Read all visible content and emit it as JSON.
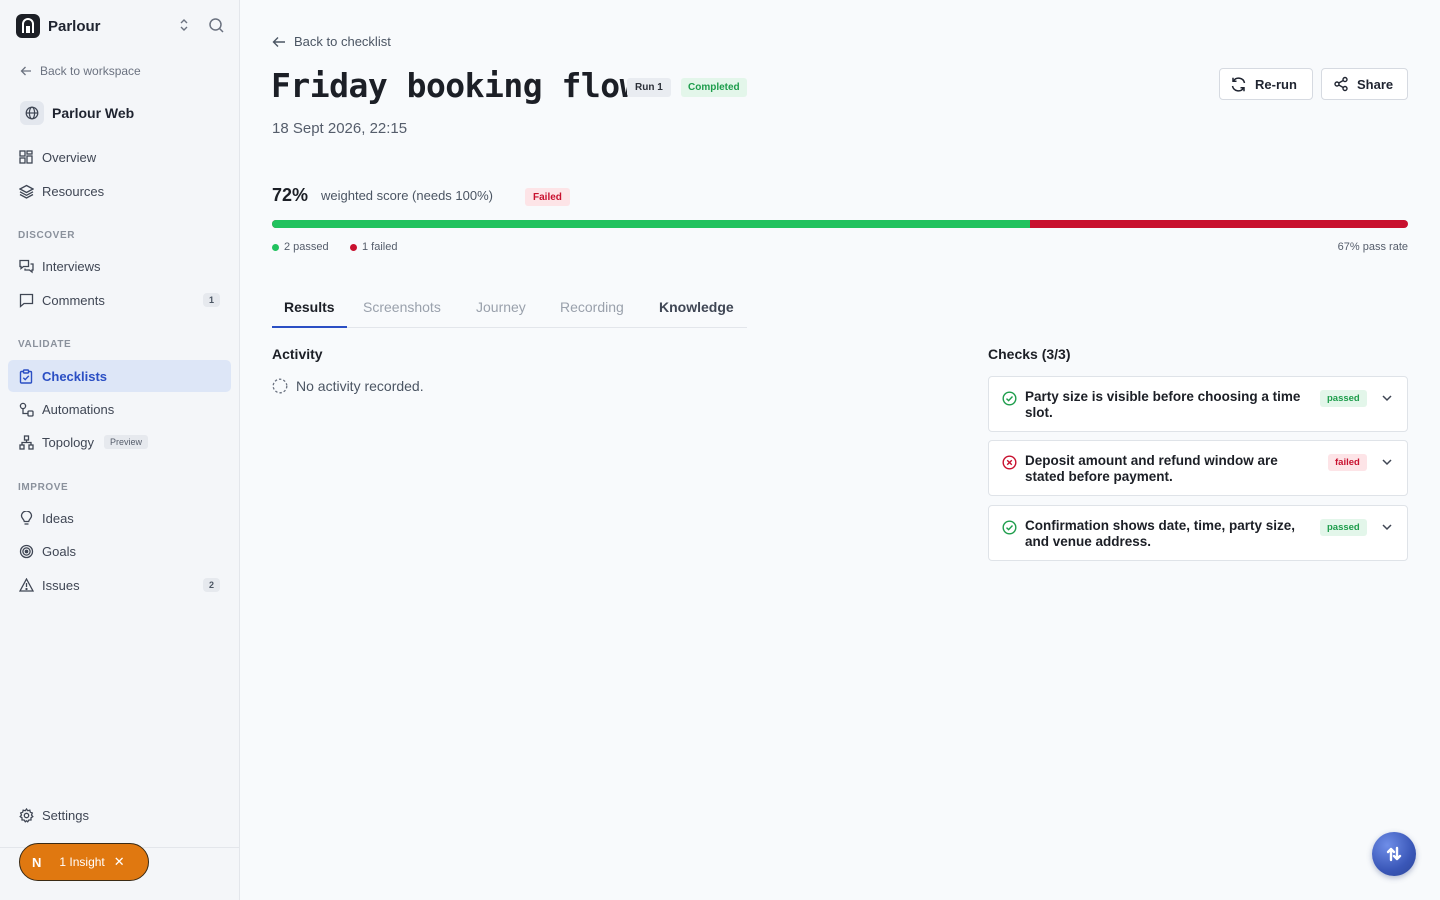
{
  "sidebar": {
    "brand": {
      "name": "Parlour"
    },
    "back_to_workspace": "Back to workspace",
    "project": {
      "name": "Parlour Web"
    },
    "nav_top": [
      {
        "label": "Overview",
        "icon": "grid-icon"
      },
      {
        "label": "Resources",
        "icon": "layers-icon"
      }
    ],
    "sections": {
      "discover": "DISCOVER",
      "validate": "VALIDATE",
      "improve": "IMPROVE"
    },
    "discover_items": [
      {
        "label": "Interviews",
        "icon": "chat-bubbles-icon"
      },
      {
        "label": "Comments",
        "icon": "comment-icon",
        "count": "1"
      }
    ],
    "validate_items": [
      {
        "label": "Checklists",
        "icon": "clipboard-check-icon",
        "active": true
      },
      {
        "label": "Automations",
        "icon": "automation-icon"
      },
      {
        "label": "Topology",
        "icon": "topology-icon",
        "tag": "Preview"
      }
    ],
    "improve_items": [
      {
        "label": "Ideas",
        "icon": "lightbulb-icon"
      },
      {
        "label": "Goals",
        "icon": "target-icon"
      },
      {
        "label": "Issues",
        "icon": "warning-icon",
        "count": "2"
      }
    ],
    "settings": "Settings",
    "insight": {
      "logo": "N",
      "label": "1 Insight",
      "close": "✕"
    }
  },
  "main": {
    "back_label": "Back to checklist",
    "title": "Friday booking flow",
    "run_badge": "Run 1",
    "status_badge": "Completed",
    "date": "18 Sept 2026, 22:15",
    "actions": {
      "rerun": "Re-run",
      "share": "Share"
    },
    "score": {
      "value": "72%",
      "description": "weighted score (needs 100%)",
      "result": "Failed",
      "pass_fraction": 0.667,
      "passed_label": "2 passed",
      "failed_label": "1 failed",
      "pass_rate": "67% pass rate"
    },
    "tabs": [
      "Results",
      "Screenshots",
      "Journey",
      "Recording",
      "Knowledge"
    ],
    "activity": {
      "heading": "Activity",
      "empty": "No activity recorded."
    },
    "checks": {
      "heading": "Checks (3/3)",
      "items": [
        {
          "text": "Party size is visible before choosing a time slot.",
          "status": "passed"
        },
        {
          "text": "Deposit amount and refund window are stated before payment.",
          "status": "failed"
        },
        {
          "text": "Confirmation shows date, time, party size, and venue address.",
          "status": "passed"
        }
      ]
    }
  },
  "colors": {
    "accent": "#2b4fc4",
    "pass": "#21c25e",
    "fail": "#c8102e",
    "insight": "#e07810"
  }
}
